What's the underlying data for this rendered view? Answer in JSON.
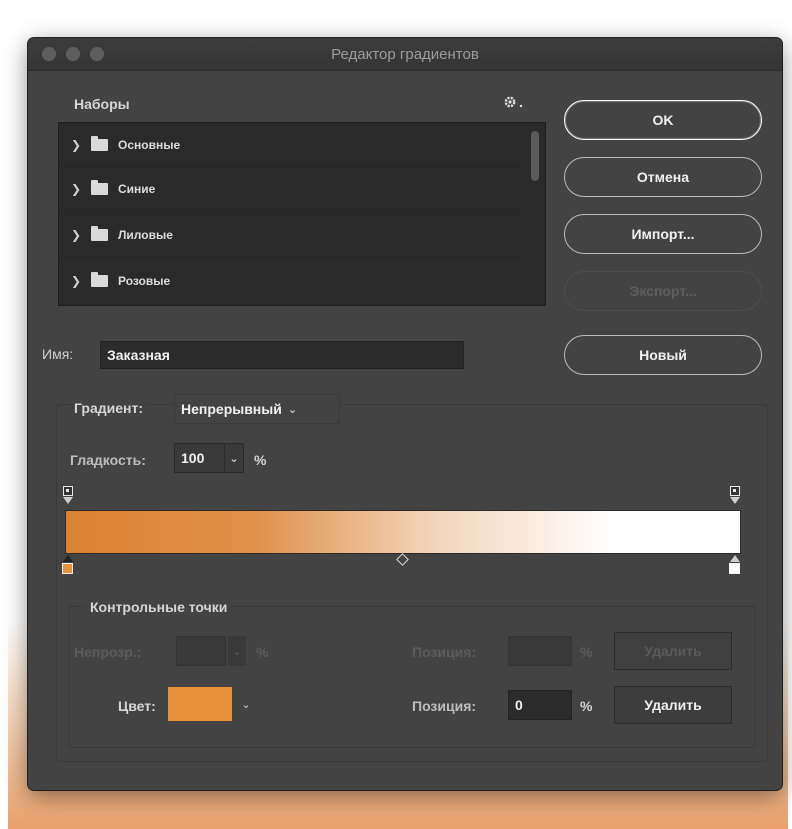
{
  "window": {
    "title": "Редактор градиентов"
  },
  "presets": {
    "label": "Наборы",
    "gear_icon": "gear-icon",
    "items": [
      {
        "label": "Основные"
      },
      {
        "label": "Синие"
      },
      {
        "label": "Лиловые"
      },
      {
        "label": "Розовые"
      }
    ]
  },
  "buttons": {
    "ok": "OK",
    "cancel": "Отмена",
    "import": "Импорт...",
    "export": "Экспорт...",
    "new": "Новый"
  },
  "name": {
    "label": "Имя:",
    "value": "Заказная"
  },
  "gradient": {
    "type_label": "Градиент:",
    "type_value": "Непрерывный",
    "smoothness_label": "Гладкость:",
    "smoothness_value": "100",
    "smoothness_unit": "%",
    "start_color": "#dc8233",
    "end_color": "#ffffff"
  },
  "stops": {
    "group_label": "Контрольные точки",
    "opacity_label": "Непрозр.:",
    "opacity_unit": "%",
    "opacity_position_label": "Позиция:",
    "opacity_position_unit": "%",
    "opacity_delete": "Удалить",
    "color_label": "Цвет:",
    "color_value": "#e8913d",
    "color_position_label": "Позиция:",
    "color_position_value": "0",
    "color_position_unit": "%",
    "color_delete": "Удалить"
  }
}
